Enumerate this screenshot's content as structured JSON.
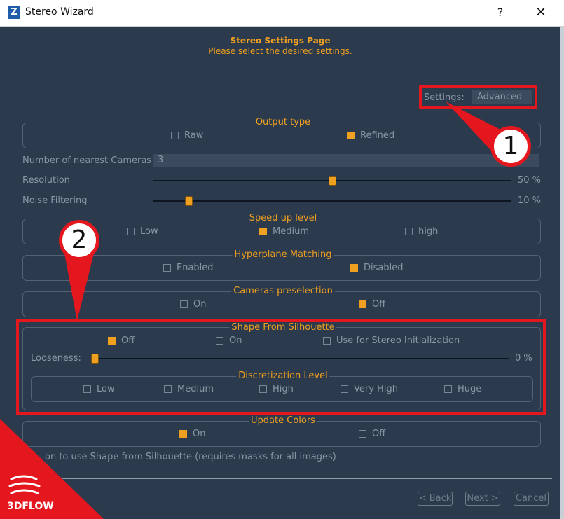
{
  "window": {
    "title": "Stereo Wizard",
    "app_icon": "Z",
    "help_label": "?",
    "close_label": "✕"
  },
  "header": {
    "title": "Stereo Settings Page",
    "subtitle": "Please select the desired settings."
  },
  "settings": {
    "label": "Settings:",
    "value": "Advanced"
  },
  "output_type": {
    "title": "Output type",
    "options": [
      {
        "label": "Raw",
        "checked": false
      },
      {
        "label": "Refined",
        "checked": true
      }
    ]
  },
  "nearest_cameras": {
    "label": "Number of nearest Cameras",
    "value": "3"
  },
  "resolution": {
    "label": "Resolution",
    "value_text": "50 %",
    "level": 0.5
  },
  "noise_filtering": {
    "label": "Noise Filtering",
    "value_text": "10 %",
    "level": 0.1
  },
  "speed_up": {
    "title": "Speed up level",
    "options": [
      {
        "label": "Low",
        "checked": false
      },
      {
        "label": "Medium",
        "checked": true
      },
      {
        "label": "high",
        "checked": false
      }
    ]
  },
  "hyperplane": {
    "title": "Hyperplane Matching",
    "options": [
      {
        "label": "Enabled",
        "checked": false
      },
      {
        "label": "Disabled",
        "checked": true
      }
    ]
  },
  "cameras_preselection": {
    "title": "Cameras preselection",
    "options": [
      {
        "label": "On",
        "checked": false
      },
      {
        "label": "Off",
        "checked": true
      }
    ]
  },
  "shape_from_silhouette": {
    "title": "Shape From Silhouette",
    "options": [
      {
        "label": "Off",
        "checked": true
      },
      {
        "label": "On",
        "checked": false
      },
      {
        "label": "Use for Stereo Initialization",
        "checked": false
      }
    ],
    "looseness": {
      "label": "Looseness:",
      "value_text": "0 %",
      "level": 0
    },
    "discretization": {
      "title": "Discretization Level",
      "options": [
        {
          "label": "Low",
          "checked": false
        },
        {
          "label": "Medium",
          "checked": false
        },
        {
          "label": "High",
          "checked": false
        },
        {
          "label": "Very High",
          "checked": false
        },
        {
          "label": "Huge",
          "checked": false
        }
      ]
    }
  },
  "update_colors": {
    "title": "Update Colors",
    "options": [
      {
        "label": "On",
        "checked": true
      },
      {
        "label": "Off",
        "checked": false
      }
    ]
  },
  "hint": "on to use Shape from Silhouette (requires masks for all images)",
  "footer": {
    "back_label": "< Back",
    "next_label": "Next >",
    "cancel_label": "Cancel"
  },
  "annotations": {
    "badge_1": "1",
    "badge_2": "2"
  },
  "logo": {
    "text": "3DFLOW"
  },
  "colors": {
    "accent": "#f0a020",
    "background": "#2b3a4d",
    "highlight": "#e3171d",
    "muted_text": "#8b97a5"
  }
}
